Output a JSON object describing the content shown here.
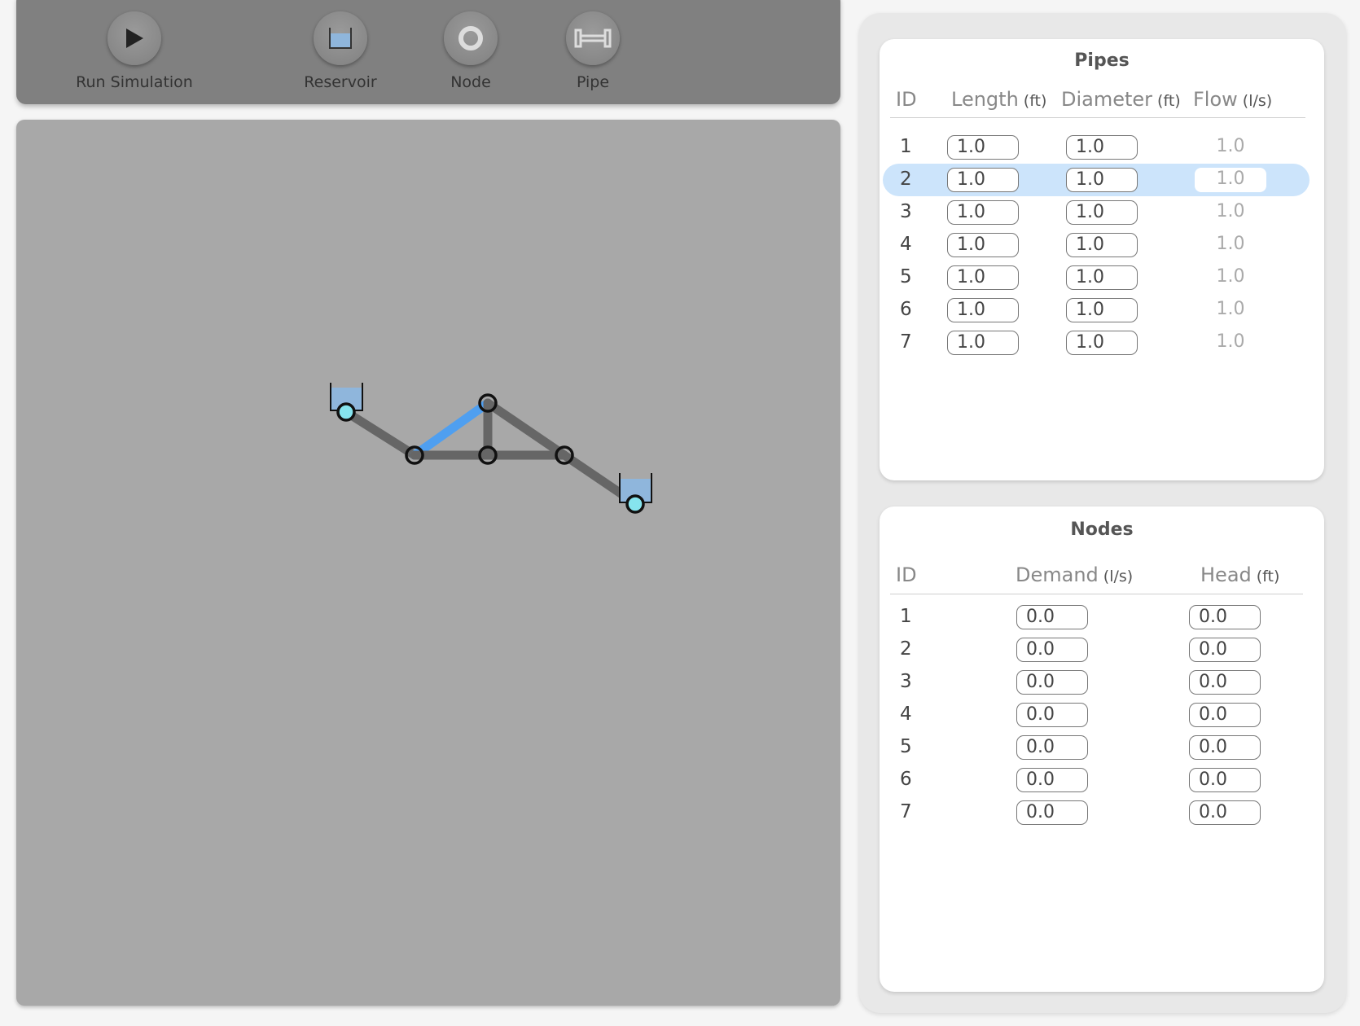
{
  "toolbar": {
    "run_label": "Run Simulation",
    "reservoir_label": "Reservoir",
    "node_label": "Node",
    "pipe_label": "Pipe"
  },
  "colors": {
    "selected_pipe": "#4f9ff0",
    "pipe": "#666666",
    "reservoir_water": "#8fb6dc",
    "reservoir_node": "#86e4ee",
    "row_highlight": "#cce4fb"
  },
  "pipes_panel": {
    "title": "Pipes",
    "headers": {
      "id": "ID",
      "length": "Length",
      "length_unit": "(ft)",
      "diameter": "Diameter",
      "diameter_unit": "(ft)",
      "flow": "Flow",
      "flow_unit": "(l/s)"
    },
    "selected_row": 2,
    "rows": [
      {
        "id": "1",
        "length": "1.0",
        "diameter": "1.0",
        "flow": "1.0"
      },
      {
        "id": "2",
        "length": "1.0",
        "diameter": "1.0",
        "flow": "1.0"
      },
      {
        "id": "3",
        "length": "1.0",
        "diameter": "1.0",
        "flow": "1.0"
      },
      {
        "id": "4",
        "length": "1.0",
        "diameter": "1.0",
        "flow": "1.0"
      },
      {
        "id": "5",
        "length": "1.0",
        "diameter": "1.0",
        "flow": "1.0"
      },
      {
        "id": "6",
        "length": "1.0",
        "diameter": "1.0",
        "flow": "1.0"
      },
      {
        "id": "7",
        "length": "1.0",
        "diameter": "1.0",
        "flow": "1.0"
      }
    ]
  },
  "nodes_panel": {
    "title": "Nodes",
    "headers": {
      "id": "ID",
      "demand": "Demand",
      "demand_unit": "(l/s)",
      "head": "Head",
      "head_unit": "(ft)"
    },
    "rows": [
      {
        "id": "1",
        "demand": "0.0",
        "head": "0.0"
      },
      {
        "id": "2",
        "demand": "0.0",
        "head": "0.0"
      },
      {
        "id": "3",
        "demand": "0.0",
        "head": "0.0"
      },
      {
        "id": "4",
        "demand": "0.0",
        "head": "0.0"
      },
      {
        "id": "5",
        "demand": "0.0",
        "head": "0.0"
      },
      {
        "id": "6",
        "demand": "0.0",
        "head": "0.0"
      },
      {
        "id": "7",
        "demand": "0.0",
        "head": "0.0"
      }
    ]
  }
}
